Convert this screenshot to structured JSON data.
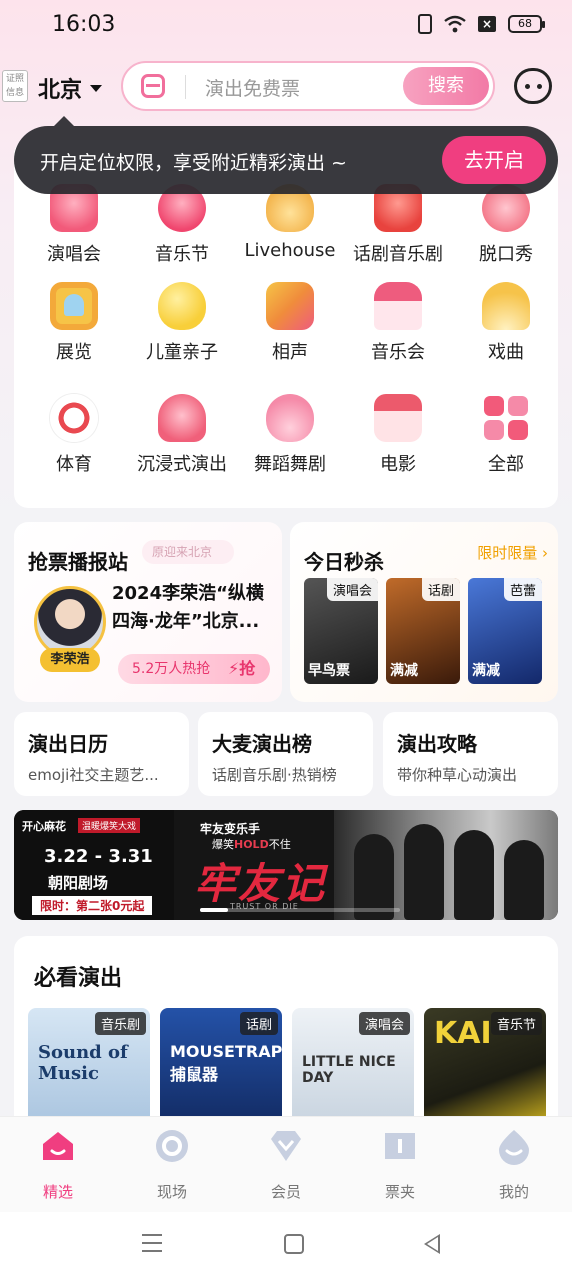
{
  "status_bar": {
    "time": "16:03",
    "battery": "68"
  },
  "header": {
    "cert_badge": "证照信息",
    "city": "北京",
    "search_placeholder": "演出免费票",
    "search_button": "搜索"
  },
  "location_tip": {
    "text": "开启定位权限，享受附近精彩演出 ~",
    "button": "去开启"
  },
  "categories": [
    {
      "label": "演唱会",
      "icon": "microphone-icon",
      "color": "#f25a7a"
    },
    {
      "label": "音乐节",
      "icon": "guitar-pick-icon",
      "color": "#f0466e"
    },
    {
      "label": "Livehouse",
      "icon": "guitar-icon",
      "color": "#f3b34a"
    },
    {
      "label": "话剧音乐剧",
      "icon": "mask-icon",
      "color": "#e8433e"
    },
    {
      "label": "脱口秀",
      "icon": "mouth-icon",
      "color": "#f47a8b"
    },
    {
      "label": "展览",
      "icon": "picture-frame-icon",
      "color": "#f6c447"
    },
    {
      "label": "儿童亲子",
      "icon": "duck-icon",
      "color": "#f8cf3a"
    },
    {
      "label": "相声",
      "icon": "fan-book-icon",
      "color": "#f08c3c"
    },
    {
      "label": "音乐会",
      "icon": "piano-icon",
      "color": "#ee5c7e"
    },
    {
      "label": "戏曲",
      "icon": "folding-fan-icon",
      "color": "#f6c34a"
    },
    {
      "label": "体育",
      "icon": "soccer-ball-icon",
      "color": "#e94950"
    },
    {
      "label": "沉浸式演出",
      "icon": "vr-headset-icon",
      "color": "#f0607a"
    },
    {
      "label": "舞蹈舞剧",
      "icon": "dancer-icon",
      "color": "#f58aa8"
    },
    {
      "label": "电影",
      "icon": "clapperboard-icon",
      "color": "#ec5a6c"
    },
    {
      "label": "全部",
      "icon": "grid-icon",
      "color": "#f25a7a"
    }
  ],
  "broadcast": {
    "title": "抢票播报站",
    "tag": "原迎来北京",
    "artist": "李荣浩",
    "desc": "2024李荣浩“纵横四海·龙年”北京...",
    "hot": "5.2万人热抢",
    "hot_icon": "抢"
  },
  "flash_sale": {
    "title": "今日秒杀",
    "tag": "限时限量",
    "items": [
      {
        "tag": "演唱会",
        "foot": "早鸟票",
        "bg": "#2a2a2a"
      },
      {
        "tag": "话剧",
        "foot": "满减",
        "bg": "#6b3a1c"
      },
      {
        "tag": "芭蕾",
        "foot": "满减",
        "bg": "#1d3c8a"
      }
    ]
  },
  "quick_links": [
    {
      "title": "演出日历",
      "sub": "emoji社交主题艺..."
    },
    {
      "title": "大麦演出榜",
      "sub": "话剧音乐剧·热销榜"
    },
    {
      "title": "演出攻略",
      "sub": "带你种草心动演出"
    }
  ],
  "banner": {
    "brand": "开心麻花",
    "brand_tag": "温暖爆笑大戏",
    "date": "3.22 - 3.31",
    "venue": "朝阳剧场",
    "promo": "限时：第二张0元起",
    "sub1": "牢友变乐手",
    "sub2_pre": "爆笑",
    "sub2_em": "HOLD",
    "sub2_post": "不住",
    "title": "牢友记",
    "en": "TRUST OR DIE"
  },
  "must_see": {
    "title": "必看演出",
    "items": [
      {
        "tag": "音乐剧",
        "text": "Sound of Music",
        "bg": "#bcd4ea",
        "fg": "#1b3c6b"
      },
      {
        "tag": "话剧",
        "text": "MOUSETRAP 捕鼠器",
        "bg": "#1a3e8c",
        "fg": "#ffffff"
      },
      {
        "tag": "演唱会",
        "text": "LITTLE NICE DAY",
        "bg": "#d8e4ef",
        "fg": "#333333"
      },
      {
        "tag": "音乐节",
        "text": "KAI",
        "bg": "#2b2b1c",
        "fg": "#f1d23a"
      }
    ]
  },
  "bottom_nav": [
    {
      "label": "精选",
      "icon": "home-icon",
      "active": true
    },
    {
      "label": "现场",
      "icon": "live-icon",
      "active": false
    },
    {
      "label": "会员",
      "icon": "diamond-icon",
      "active": false
    },
    {
      "label": "票夹",
      "icon": "ticket-icon",
      "active": false
    },
    {
      "label": "我的",
      "icon": "profile-icon",
      "active": false
    }
  ],
  "colors": {
    "accent": "#f03e80",
    "search_border": "#f7b3cc",
    "flash_tag": "#f0a000"
  }
}
